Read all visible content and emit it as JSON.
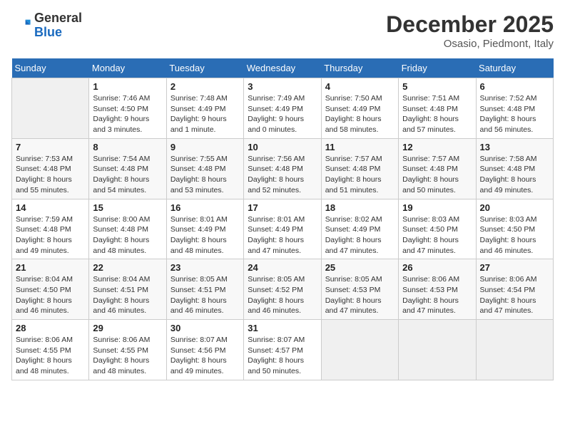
{
  "header": {
    "logo_line1": "General",
    "logo_line2": "Blue",
    "month": "December 2025",
    "location": "Osasio, Piedmont, Italy"
  },
  "days_of_week": [
    "Sunday",
    "Monday",
    "Tuesday",
    "Wednesday",
    "Thursday",
    "Friday",
    "Saturday"
  ],
  "weeks": [
    [
      {
        "day": "",
        "info": ""
      },
      {
        "day": "1",
        "info": "Sunrise: 7:46 AM\nSunset: 4:50 PM\nDaylight: 9 hours\nand 3 minutes."
      },
      {
        "day": "2",
        "info": "Sunrise: 7:48 AM\nSunset: 4:49 PM\nDaylight: 9 hours\nand 1 minute."
      },
      {
        "day": "3",
        "info": "Sunrise: 7:49 AM\nSunset: 4:49 PM\nDaylight: 9 hours\nand 0 minutes."
      },
      {
        "day": "4",
        "info": "Sunrise: 7:50 AM\nSunset: 4:49 PM\nDaylight: 8 hours\nand 58 minutes."
      },
      {
        "day": "5",
        "info": "Sunrise: 7:51 AM\nSunset: 4:48 PM\nDaylight: 8 hours\nand 57 minutes."
      },
      {
        "day": "6",
        "info": "Sunrise: 7:52 AM\nSunset: 4:48 PM\nDaylight: 8 hours\nand 56 minutes."
      }
    ],
    [
      {
        "day": "7",
        "info": "Sunrise: 7:53 AM\nSunset: 4:48 PM\nDaylight: 8 hours\nand 55 minutes."
      },
      {
        "day": "8",
        "info": "Sunrise: 7:54 AM\nSunset: 4:48 PM\nDaylight: 8 hours\nand 54 minutes."
      },
      {
        "day": "9",
        "info": "Sunrise: 7:55 AM\nSunset: 4:48 PM\nDaylight: 8 hours\nand 53 minutes."
      },
      {
        "day": "10",
        "info": "Sunrise: 7:56 AM\nSunset: 4:48 PM\nDaylight: 8 hours\nand 52 minutes."
      },
      {
        "day": "11",
        "info": "Sunrise: 7:57 AM\nSunset: 4:48 PM\nDaylight: 8 hours\nand 51 minutes."
      },
      {
        "day": "12",
        "info": "Sunrise: 7:57 AM\nSunset: 4:48 PM\nDaylight: 8 hours\nand 50 minutes."
      },
      {
        "day": "13",
        "info": "Sunrise: 7:58 AM\nSunset: 4:48 PM\nDaylight: 8 hours\nand 49 minutes."
      }
    ],
    [
      {
        "day": "14",
        "info": "Sunrise: 7:59 AM\nSunset: 4:48 PM\nDaylight: 8 hours\nand 49 minutes."
      },
      {
        "day": "15",
        "info": "Sunrise: 8:00 AM\nSunset: 4:48 PM\nDaylight: 8 hours\nand 48 minutes."
      },
      {
        "day": "16",
        "info": "Sunrise: 8:01 AM\nSunset: 4:49 PM\nDaylight: 8 hours\nand 48 minutes."
      },
      {
        "day": "17",
        "info": "Sunrise: 8:01 AM\nSunset: 4:49 PM\nDaylight: 8 hours\nand 47 minutes."
      },
      {
        "day": "18",
        "info": "Sunrise: 8:02 AM\nSunset: 4:49 PM\nDaylight: 8 hours\nand 47 minutes."
      },
      {
        "day": "19",
        "info": "Sunrise: 8:03 AM\nSunset: 4:50 PM\nDaylight: 8 hours\nand 47 minutes."
      },
      {
        "day": "20",
        "info": "Sunrise: 8:03 AM\nSunset: 4:50 PM\nDaylight: 8 hours\nand 46 minutes."
      }
    ],
    [
      {
        "day": "21",
        "info": "Sunrise: 8:04 AM\nSunset: 4:50 PM\nDaylight: 8 hours\nand 46 minutes."
      },
      {
        "day": "22",
        "info": "Sunrise: 8:04 AM\nSunset: 4:51 PM\nDaylight: 8 hours\nand 46 minutes."
      },
      {
        "day": "23",
        "info": "Sunrise: 8:05 AM\nSunset: 4:51 PM\nDaylight: 8 hours\nand 46 minutes."
      },
      {
        "day": "24",
        "info": "Sunrise: 8:05 AM\nSunset: 4:52 PM\nDaylight: 8 hours\nand 46 minutes."
      },
      {
        "day": "25",
        "info": "Sunrise: 8:05 AM\nSunset: 4:53 PM\nDaylight: 8 hours\nand 47 minutes."
      },
      {
        "day": "26",
        "info": "Sunrise: 8:06 AM\nSunset: 4:53 PM\nDaylight: 8 hours\nand 47 minutes."
      },
      {
        "day": "27",
        "info": "Sunrise: 8:06 AM\nSunset: 4:54 PM\nDaylight: 8 hours\nand 47 minutes."
      }
    ],
    [
      {
        "day": "28",
        "info": "Sunrise: 8:06 AM\nSunset: 4:55 PM\nDaylight: 8 hours\nand 48 minutes."
      },
      {
        "day": "29",
        "info": "Sunrise: 8:06 AM\nSunset: 4:55 PM\nDaylight: 8 hours\nand 48 minutes."
      },
      {
        "day": "30",
        "info": "Sunrise: 8:07 AM\nSunset: 4:56 PM\nDaylight: 8 hours\nand 49 minutes."
      },
      {
        "day": "31",
        "info": "Sunrise: 8:07 AM\nSunset: 4:57 PM\nDaylight: 8 hours\nand 50 minutes."
      },
      {
        "day": "",
        "info": ""
      },
      {
        "day": "",
        "info": ""
      },
      {
        "day": "",
        "info": ""
      }
    ]
  ]
}
